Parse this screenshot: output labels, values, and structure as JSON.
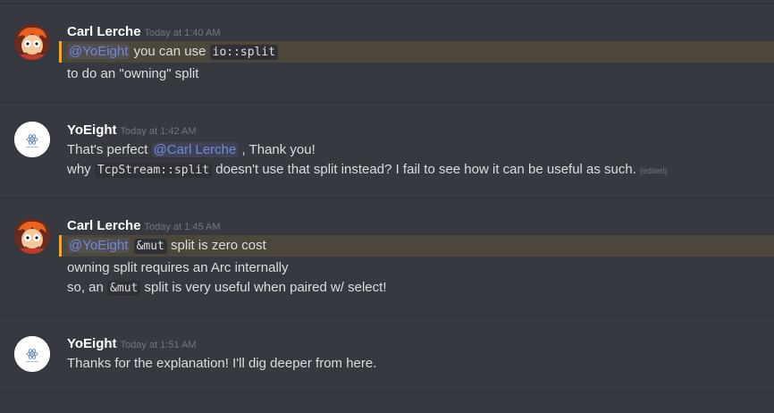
{
  "messages": [
    {
      "author": "Carl Lerche",
      "timestamp": "Today at 1:40 AM",
      "avatar_icon": "fry-avatar",
      "line1": {
        "mention": "@YoEight",
        "pre": "you can use",
        "code": "io::split"
      },
      "line2": "to do an \"owning\" split"
    },
    {
      "author": "YoEight",
      "timestamp": "Today at 1:42 AM",
      "avatar_icon": "yoeight-avatar",
      "line1": {
        "pre": "That's perfect",
        "mention": "@Carl Lerche",
        "post": ", Thank you!"
      },
      "line2": {
        "pre": "why",
        "code": "TcpStream::split",
        "post": "doesn't use that split instead? I fail to see how it can be useful as such.",
        "edited": "(edited)"
      }
    },
    {
      "author": "Carl Lerche",
      "timestamp": "Today at 1:45 AM",
      "avatar_icon": "fry-avatar",
      "line1": {
        "mention": "@YoEight",
        "code": "&mut",
        "post": "split is zero cost"
      },
      "line2": "owning split requires an Arc internally",
      "line3": {
        "pre": "so, an",
        "code": "&mut",
        "post": "split is very useful when paired w/ select!"
      }
    },
    {
      "author": "YoEight",
      "timestamp": "Today at 1:51 AM",
      "avatar_icon": "yoeight-avatar",
      "line1": "Thanks for the explanation! I'll dig deeper from here."
    }
  ],
  "colors": {
    "background": "#36393f",
    "mention_highlight": "#faa61a",
    "mention_text": "#7289da"
  }
}
